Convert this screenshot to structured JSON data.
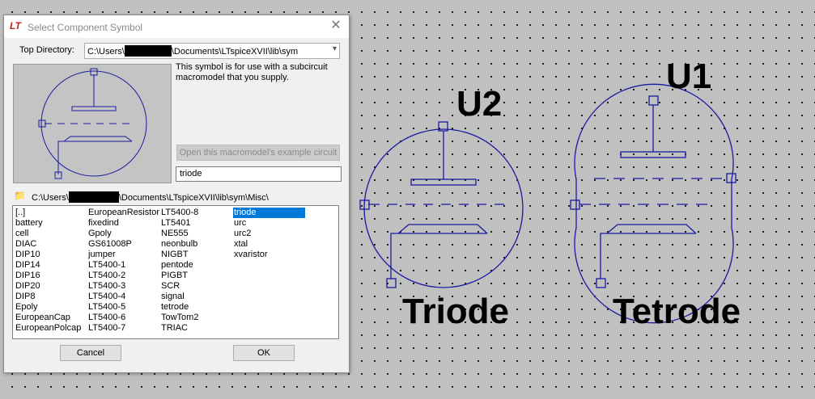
{
  "dialog": {
    "title": "Select Component Symbol",
    "app_icon": "LT",
    "close_glyph": "✕",
    "top_dir_label": "Top Directory:",
    "top_dir_prefix": "C:\\Users\\",
    "top_dir_suffix": "\\Documents\\LTspiceXVII\\lib\\sym",
    "combo_chevron": "▾",
    "description": "This symbol is for use with a subcircuit macromodel that you supply.",
    "open_example_label": "Open this macromodel's example circuit",
    "symbol_name": "triode",
    "path_prefix": "C:\\Users\\",
    "path_suffix": "\\Documents\\LTspiceXVII\\lib\\sym\\Misc\\",
    "cancel_label": "Cancel",
    "ok_label": "OK",
    "selected_item": "triode",
    "columns": [
      [
        "[..]",
        "battery",
        "cell",
        "DIAC",
        "DIP10",
        "DIP14",
        "DIP16",
        "DIP20",
        "DIP8",
        "Epoly",
        "EuropeanCap",
        "EuropeanPolcap"
      ],
      [
        "EuropeanResistor",
        "fixedind",
        "Gpoly",
        "GS61008P",
        "jumper",
        "LT5400-1",
        "LT5400-2",
        "LT5400-3",
        "LT5400-4",
        "LT5400-5",
        "LT5400-6",
        "LT5400-7"
      ],
      [
        "LT5400-8",
        "LT5401",
        "NE555",
        "neonbulb",
        "NIGBT",
        "pentode",
        "PIGBT",
        "SCR",
        "signal",
        "tetrode",
        "TowTom2",
        "TRIAC"
      ],
      [
        "triode",
        "urc",
        "urc2",
        "xtal",
        "xvaristor"
      ]
    ]
  },
  "schematic": {
    "u2_ref": "U2",
    "u2_value": "Triode",
    "u1_ref": "U1",
    "u1_value": "Tetrode",
    "wire_color": "#1a1aa0"
  }
}
